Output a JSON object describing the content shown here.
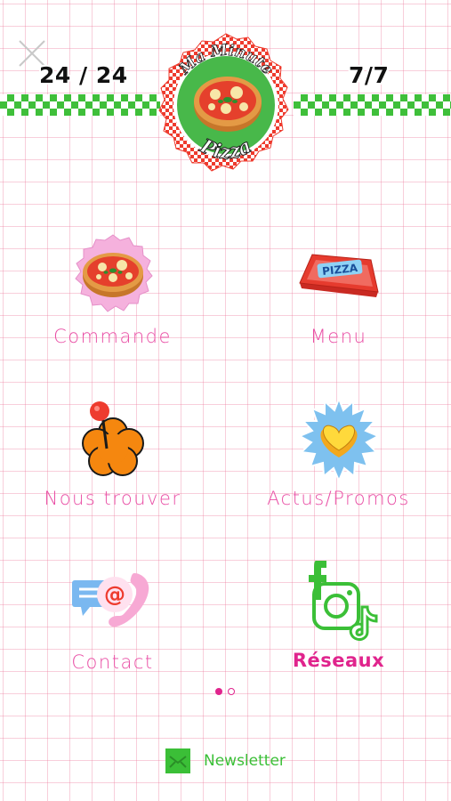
{
  "header": {
    "close_icon": "close-x-icon",
    "hours": "24 / 24",
    "days": "7/7",
    "logo": {
      "top_text": "Ma Minute",
      "bottom_text": "Pizza"
    },
    "band_color": "#3fbf3a"
  },
  "menu": {
    "items": [
      {
        "label": "Commande",
        "icon": "pizza-icon"
      },
      {
        "label": "Menu",
        "icon": "pizza-box-icon"
      },
      {
        "label": "Nous trouver",
        "icon": "map-pin-flower-icon"
      },
      {
        "label": "Actus/Promos",
        "icon": "heart-badge-icon"
      },
      {
        "label": "Contact",
        "icon": "contact-chat-phone-icon"
      },
      {
        "label": "Réseaux",
        "icon": "social-networks-icon"
      }
    ],
    "label_color": "#e94ea5"
  },
  "pagination": {
    "pages": 2,
    "current": 1
  },
  "footer": {
    "newsletter_label": "Newsletter",
    "newsletter_icon": "mail-icon",
    "color": "#3bbf37"
  }
}
